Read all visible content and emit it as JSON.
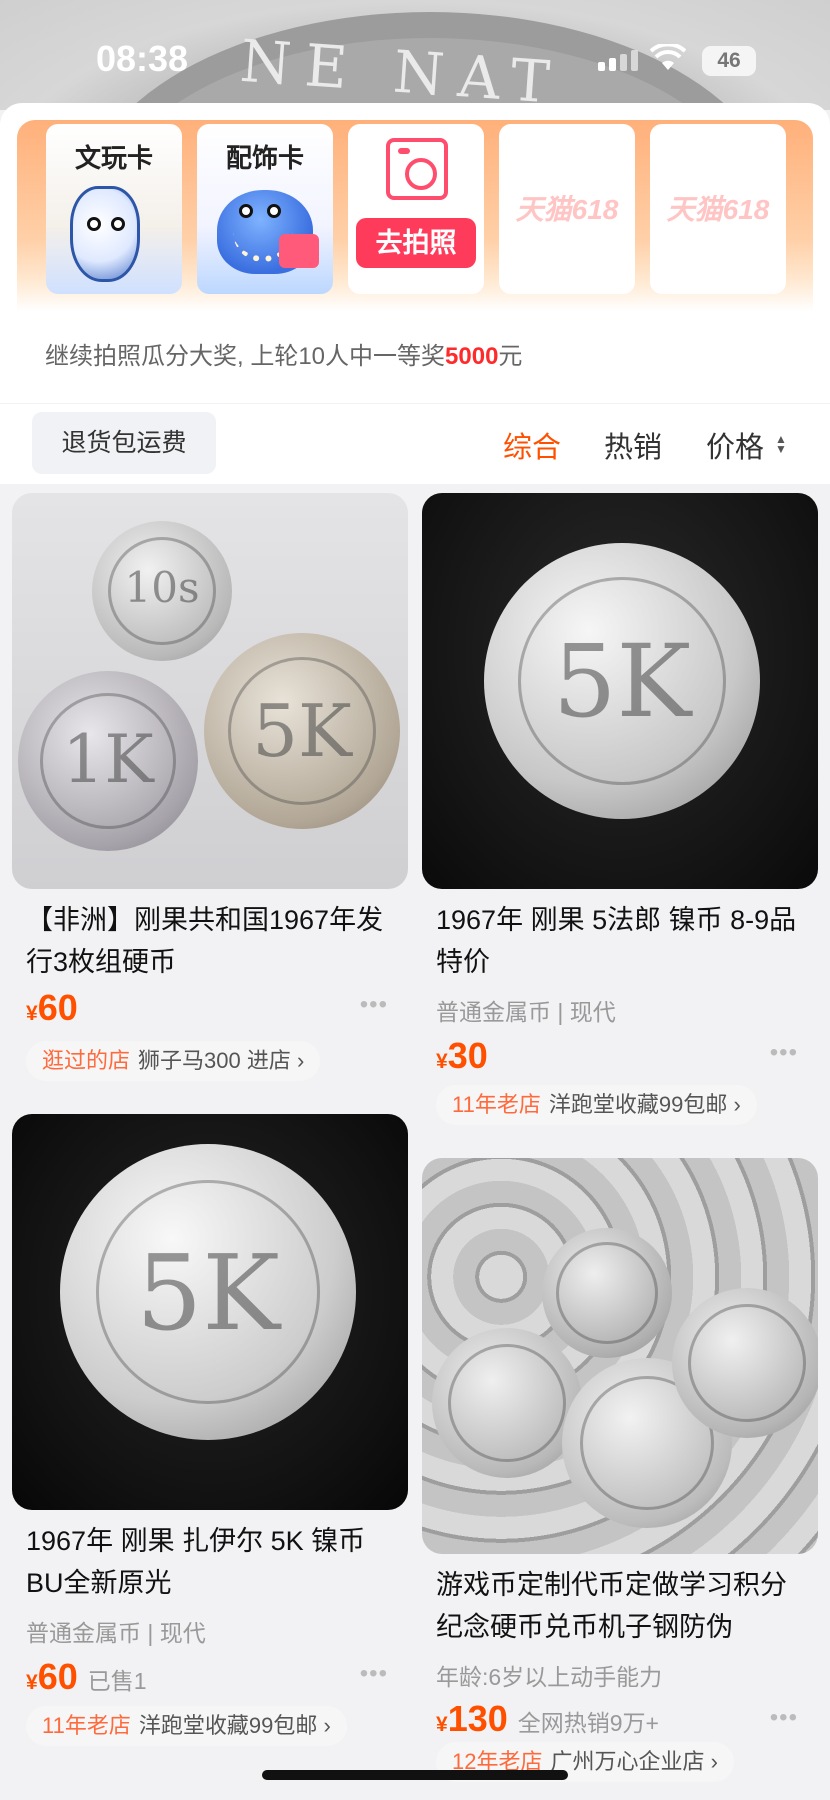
{
  "status_bar": {
    "time": "08:38",
    "battery": "46"
  },
  "camera_panel": {
    "cards": [
      {
        "label": "文玩卡"
      },
      {
        "label": "配饰卡"
      },
      {
        "button": "去拍照"
      },
      {
        "label": "天猫618"
      },
      {
        "label": "天猫618"
      }
    ],
    "tip_prefix": "继续拍照瓜分大奖, 上轮10人中一等奖",
    "tip_amount": "5000",
    "tip_suffix": "元"
  },
  "sort_bar": {
    "filter_chip": "退货包运费",
    "options": [
      "综合",
      "热销",
      "价格"
    ],
    "active": "综合"
  },
  "products": [
    {
      "title": "【非洲】刚果共和国1967年发行3枚组硬币",
      "price": "60",
      "shop_tag": "逛过的店",
      "shop_name": "狮子马300 进店",
      "coin_text": [
        "10s",
        "1K",
        "5K"
      ]
    },
    {
      "title": "1967年 刚果 5法郎 镍币 8-9品 特价",
      "meta": "普通金属币 | 现代",
      "price": "30",
      "shop_tag": "11年老店",
      "shop_name": "洋跑堂收藏99包邮",
      "coin_text": [
        "5K"
      ]
    },
    {
      "title": "1967年 刚果 扎伊尔 5K 镍币 BU全新原光",
      "meta": "普通金属币 | 现代",
      "price": "60",
      "sold": "已售1",
      "shop_tag": "11年老店",
      "shop_name": "洋跑堂收藏99包邮",
      "coin_text": [
        "5K"
      ]
    },
    {
      "title": "游戏币定制代币定做学习积分纪念硬币兑币机子钢防伪",
      "meta": "年龄:6岁以上动手能力",
      "price": "130",
      "sold": "全网热销9万+",
      "shop_tag": "12年老店",
      "shop_name": "广州万心企业店"
    }
  ],
  "icons": [
    "signal-icon",
    "wifi-icon",
    "camera-icon",
    "more-icon",
    "chevron-right-icon",
    "sort-caret-icon"
  ]
}
